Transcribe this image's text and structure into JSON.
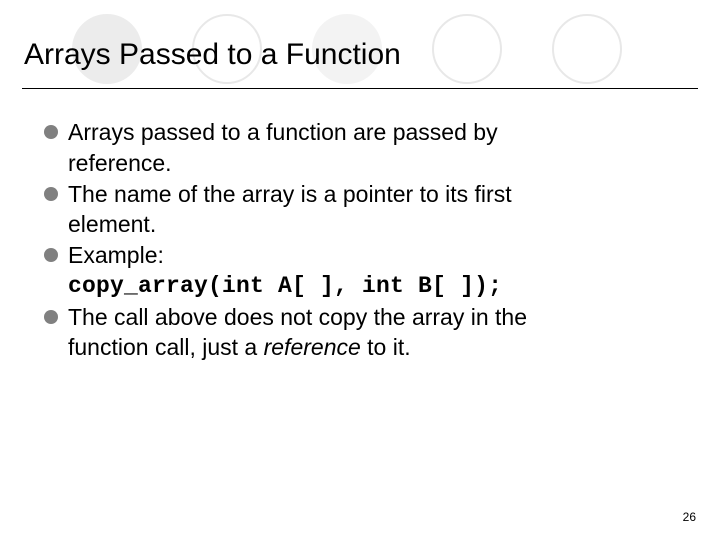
{
  "title": "Arrays Passed to a Function",
  "bullets": {
    "b1_line1": "Arrays passed to a function are passed by",
    "b1_line2": "reference.",
    "b2_line1": "The name of the array is a pointer to its first",
    "b2_line2": "element.",
    "b3_line1": " Example:",
    "b3_code": "copy_array(int A[ ], int B[ ]);",
    "b4_line1": "The call above does not copy the array in the",
    "b4_line2a": "function call, just a ",
    "b4_line2b": "reference",
    "b4_line2c": " to it."
  },
  "page_number": "26"
}
